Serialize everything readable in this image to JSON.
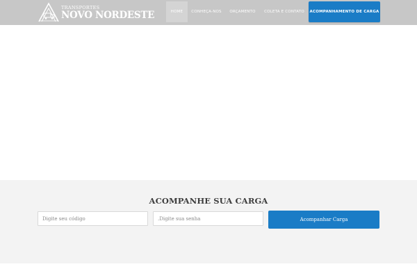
{
  "brand": {
    "small_text": "TRANSPORTES",
    "name": "NOVO NORDESTE"
  },
  "nav": {
    "items": [
      {
        "label": "HOME"
      },
      {
        "label": "CONHEÇA-NOS"
      },
      {
        "label": "ORÇAMENTO"
      },
      {
        "label": "COLETA E CONTATO"
      },
      {
        "label": "ACOMPANHAMENTO DE CARGA"
      }
    ],
    "active_index": 0
  },
  "tracking": {
    "title": "ACOMPANHE SUA CARGA",
    "code_placeholder": "Digite seu código",
    "password_placeholder": ".Digite sua senha",
    "submit_label": "Acompanhar Carga"
  },
  "colors": {
    "header_bg": "#c7c7c7",
    "accent": "#1a7cc6",
    "section_bg": "#f3f3f3"
  }
}
